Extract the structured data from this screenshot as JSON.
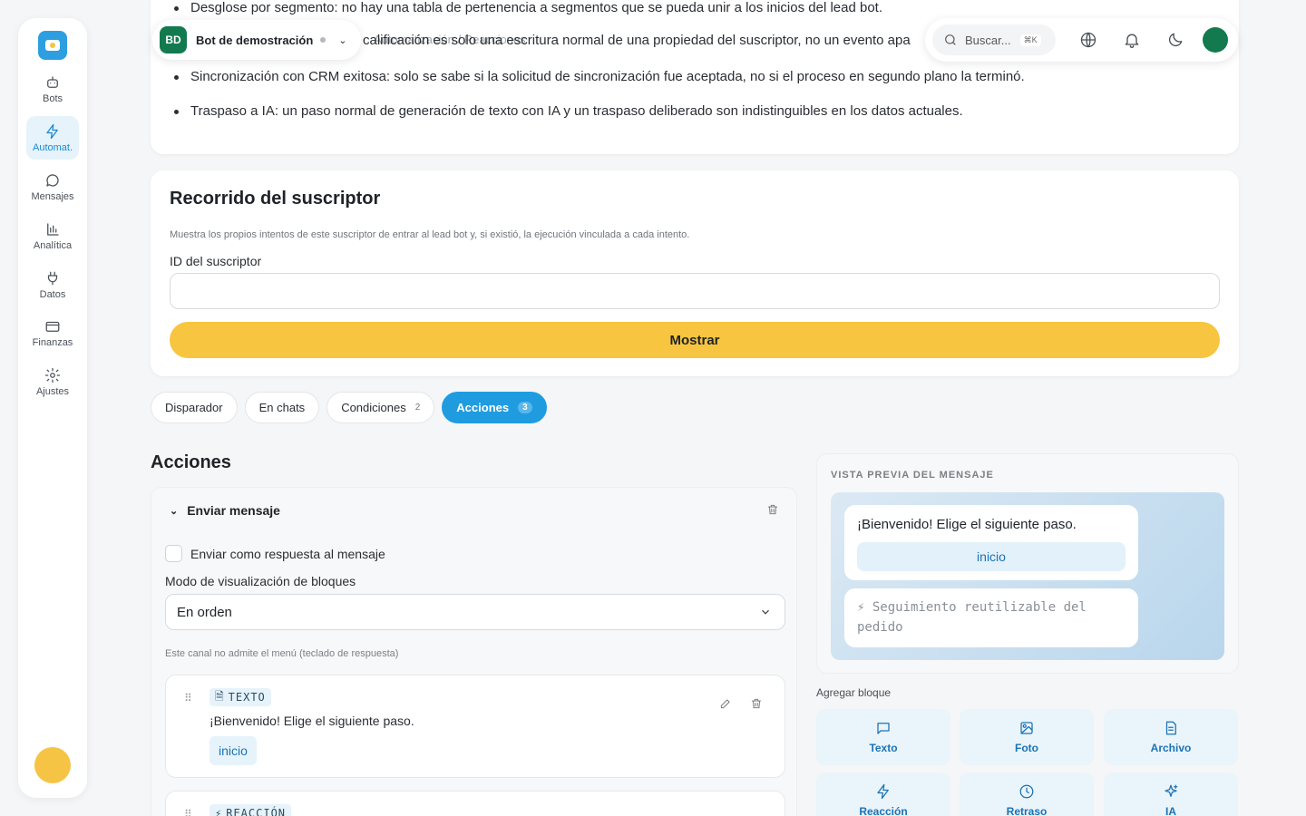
{
  "sidebar": {
    "items": [
      {
        "label": "Bots",
        "icon": "bot-icon"
      },
      {
        "label": "Automat.",
        "icon": "lightning-icon",
        "active": true
      },
      {
        "label": "Mensajes",
        "icon": "message-icon"
      },
      {
        "label": "Analítica",
        "icon": "chart-icon"
      },
      {
        "label": "Datos",
        "icon": "plug-icon"
      },
      {
        "label": "Finanzas",
        "icon": "card-icon"
      },
      {
        "label": "Ajustes",
        "icon": "gear-icon"
      }
    ]
  },
  "topbar": {
    "bot_badge": "BD",
    "bot_name": "Bot de demostración",
    "search_placeholder": "Buscar...",
    "search_shortcut": "⌘K"
  },
  "bullets": [
    "Desglose por segmento: no hay una tabla de pertenencia a segmentos que se pueda unir a los inicios del lead bot.",
    "Sincronización con CRM exitosa: solo se sabe si la solicitud de sincronización fue aceptada, no si el proceso en segundo plano la terminó.",
    "Traspaso a IA: un paso normal de generación de texto con IA y un traspaso deliberado son indistinguibles en los datos actuales."
  ],
  "overlap_text": "calificación es solo una escritura normal de una propiedad del suscriptor, no un evento apa",
  "breadcrumb_ghost": "Automatización / Reacciones",
  "journey": {
    "title": "Recorrido del suscriptor",
    "description": "Muestra los propios intentos de este suscriptor de entrar al lead bot y, si existió, la ejecución vinculada a cada intento.",
    "id_label": "ID del suscriptor",
    "id_value": "",
    "show_button": "Mostrar"
  },
  "tabs": [
    {
      "label": "Disparador",
      "count": ""
    },
    {
      "label": "En chats",
      "count": ""
    },
    {
      "label": "Condiciones",
      "count": "2"
    },
    {
      "label": "Acciones",
      "count": "3",
      "active": true
    }
  ],
  "actions": {
    "title": "Acciones",
    "panel_title": "Enviar mensaje",
    "reply_checkbox_label": "Enviar como respuesta al mensaje",
    "reply_checked": false,
    "mode_label": "Modo de visualización de bloques",
    "mode_value": "En orden",
    "note": "Este canal no admite el menú (teclado de respuesta)",
    "blocks": [
      {
        "type": "TEXTO",
        "text": "¡Bienvenido! Elige el siguiente paso.",
        "chip": "inicio"
      },
      {
        "type": "REACCIÓN"
      }
    ]
  },
  "preview": {
    "title": "VISTA PREVIA DEL MENSAJE",
    "message": "¡Bienvenido! Elige el siguiente paso.",
    "button": "inicio",
    "followup": "⚡ Seguimiento reutilizable del pedido"
  },
  "add_block": {
    "label": "Agregar bloque",
    "buttons": [
      {
        "label": "Texto",
        "icon": "message-icon"
      },
      {
        "label": "Foto",
        "icon": "image-icon"
      },
      {
        "label": "Archivo",
        "icon": "file-icon"
      },
      {
        "label": "Reacción",
        "icon": "lightning-icon"
      },
      {
        "label": "Retraso",
        "icon": "clock-icon"
      },
      {
        "label": "IA",
        "icon": "sparkles-icon"
      }
    ]
  },
  "colors": {
    "accent": "#1f9ce0",
    "primary_button": "#f7c53f",
    "bot_badge": "#137a4f"
  }
}
